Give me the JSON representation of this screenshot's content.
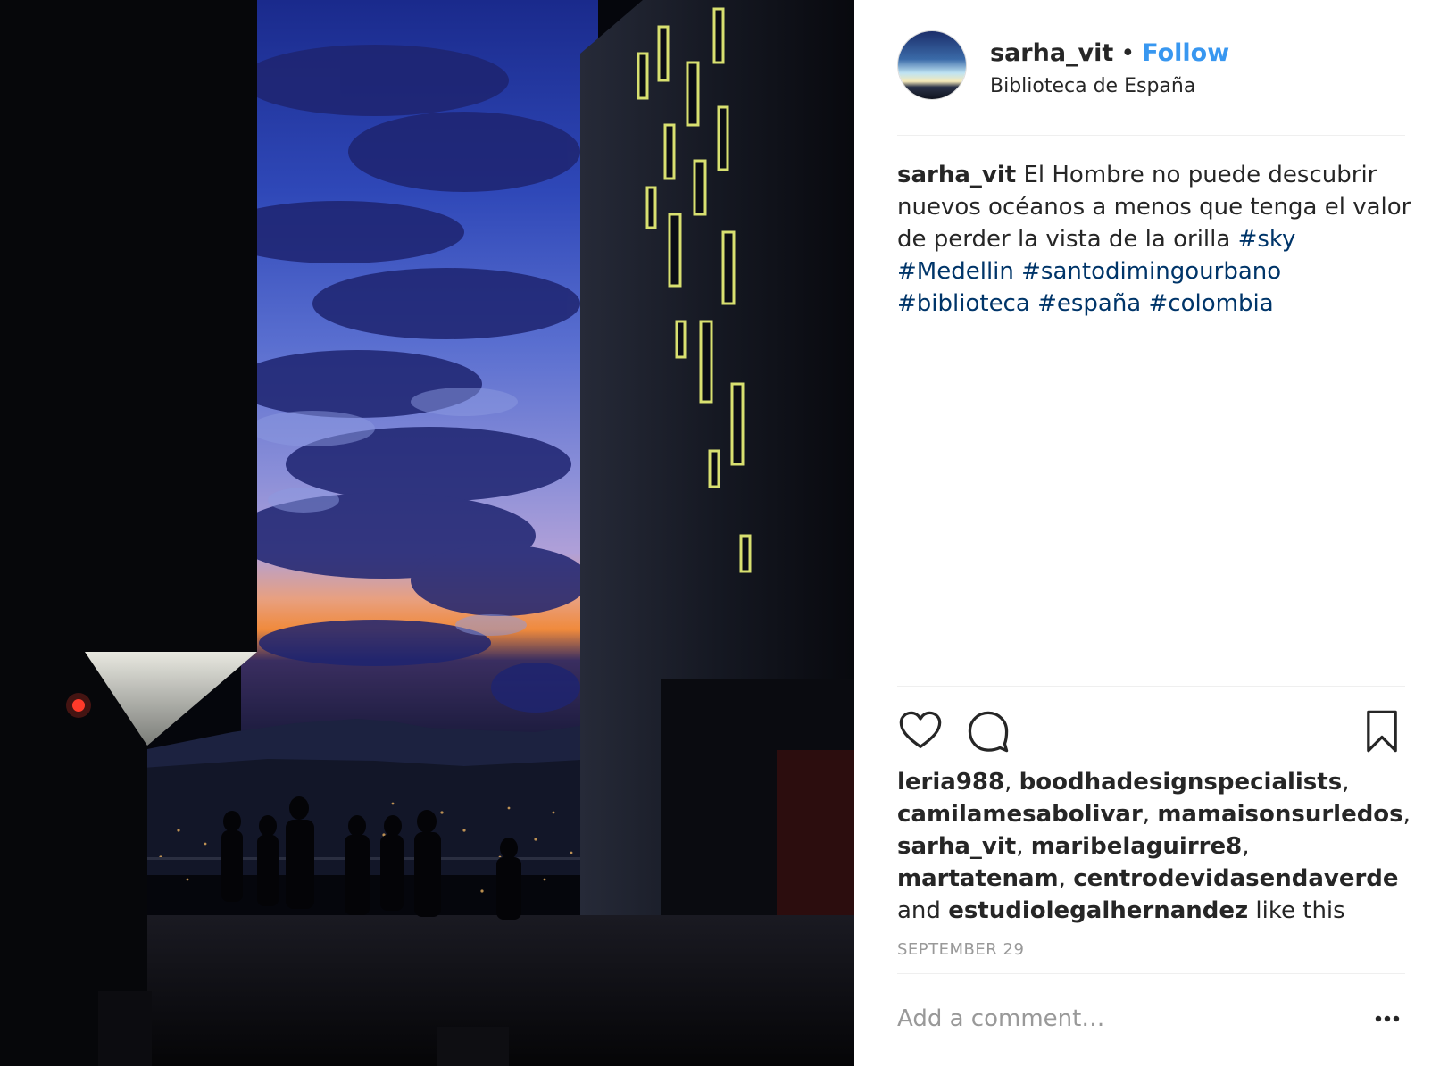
{
  "post": {
    "username": "sarha_vit",
    "separator": "•",
    "follow_label": "Follow",
    "location": "Biblioteca de España",
    "photo_description_icon": "post-photo",
    "caption": {
      "username": "sarha_vit",
      "text": "El Hombre no puede descubrir nuevos océanos a menos que tenga el valor de perder la vista de la orilla",
      "hashtags": [
        "#sky",
        "#Medellin",
        "#santodimingourbano",
        "#biblioteca",
        "#españa",
        "#colombia"
      ]
    },
    "likes": {
      "users": [
        "leria988",
        "boodhadesignspecialists",
        "camilamesabolivar",
        "mamaisonsurledos",
        "sarha_vit",
        "maribelaguirre8",
        "martatenam",
        "centrodevidasendaverde"
      ],
      "and_word": "and",
      "last_user": "estudiolegalhernandez",
      "suffix": "like this"
    },
    "date": "SEPTEMBER 29",
    "comment_placeholder": "Add a comment…",
    "icons": {
      "like": "heart-icon",
      "comment": "comment-icon",
      "save": "bookmark-icon",
      "more": "more-options-icon"
    }
  }
}
